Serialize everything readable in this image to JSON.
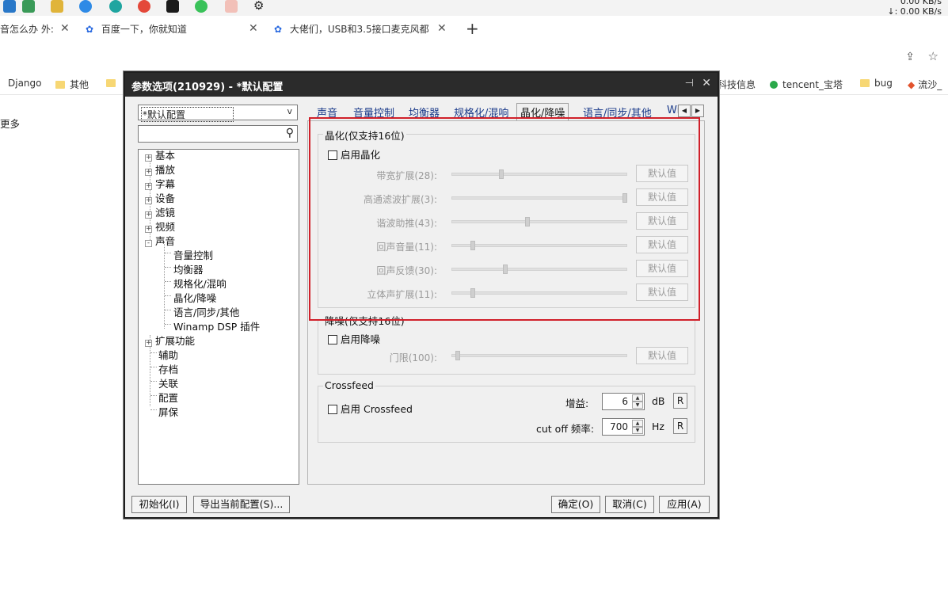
{
  "browser": {
    "net_speed_up": "0.00 KB/s",
    "net_speed_down": "↓: 0.00 KB/s",
    "tabs": [
      {
        "label": "音怎么办 外:"
      },
      {
        "label": "百度一下，你就知道"
      },
      {
        "label": "大佬们，USB和3.5接口麦克风都"
      }
    ],
    "tab_close": "✕",
    "new_tab": "+",
    "more_label": "更多",
    "bookmarks": [
      {
        "label": "Django"
      },
      {
        "label": "其他"
      },
      {
        "label": "科技信息"
      },
      {
        "label": "tencent_宝塔"
      },
      {
        "label": "bug"
      },
      {
        "label": "流沙_"
      }
    ]
  },
  "dialog": {
    "title": "参数选项(210929) - *默认配置",
    "profile": "*默认配置",
    "profile_arrow": "v",
    "search_placeholder": "",
    "tree": {
      "top": [
        {
          "label": "基本",
          "expander": "+"
        },
        {
          "label": "播放",
          "expander": "+"
        },
        {
          "label": "字幕",
          "expander": "+"
        },
        {
          "label": "设备",
          "expander": "+"
        },
        {
          "label": "滤镜",
          "expander": "+"
        },
        {
          "label": "视频",
          "expander": "+"
        },
        {
          "label": "声音",
          "expander": "-"
        }
      ],
      "sound_children": [
        {
          "label": "音量控制"
        },
        {
          "label": "均衡器"
        },
        {
          "label": "规格化/混响"
        },
        {
          "label": "晶化/降噪"
        },
        {
          "label": "语言/同步/其他"
        },
        {
          "label": "Winamp DSP 插件"
        }
      ],
      "bottom": [
        {
          "label": "扩展功能",
          "expander": "+"
        },
        {
          "label": "辅助"
        },
        {
          "label": "存档"
        },
        {
          "label": "关联"
        },
        {
          "label": "配置"
        },
        {
          "label": "屏保"
        }
      ]
    },
    "tabs": [
      {
        "label": "声音"
      },
      {
        "label": "音量控制"
      },
      {
        "label": "均衡器"
      },
      {
        "label": "规格化/混响"
      },
      {
        "label": "晶化/降噪"
      },
      {
        "label": "语言/同步/其他"
      },
      {
        "label": "Wi"
      }
    ],
    "tab_prev": "◀",
    "tab_next": "▶",
    "crystal": {
      "title": "晶化(仅支持16位)",
      "enable_label": "启用晶化",
      "sliders": [
        {
          "label": "带宽扩展(28):",
          "value": 28,
          "max": 100
        },
        {
          "label": "高通滤波扩展(3):",
          "value": 3,
          "max": 3
        },
        {
          "label": "谐波助推(43):",
          "value": 43,
          "max": 100
        },
        {
          "label": "回声音量(11):",
          "value": 11,
          "max": 100
        },
        {
          "label": "回声反馈(30):",
          "value": 30,
          "max": 100
        },
        {
          "label": "立体声扩展(11):",
          "value": 11,
          "max": 100
        }
      ]
    },
    "denoise": {
      "title": "降噪(仅支持16位)",
      "enable_label": "启用降噪",
      "slider": {
        "label": "门限(100):",
        "value": 100,
        "max": 4000
      }
    },
    "crossfeed": {
      "title": "Crossfeed",
      "enable_label": "启用 Crossfeed",
      "gain_label": "增益:",
      "gain_value": "6",
      "gain_unit": "dB",
      "cutoff_label": "cut off 频率:",
      "cutoff_value": "700",
      "cutoff_unit": "Hz",
      "reset_label": "R"
    },
    "default_label": "默认值",
    "buttons": {
      "init": "初始化(I)",
      "export": "导出当前配置(S)...",
      "ok": "确定(O)",
      "cancel": "取消(C)",
      "apply": "应用(A)"
    }
  }
}
